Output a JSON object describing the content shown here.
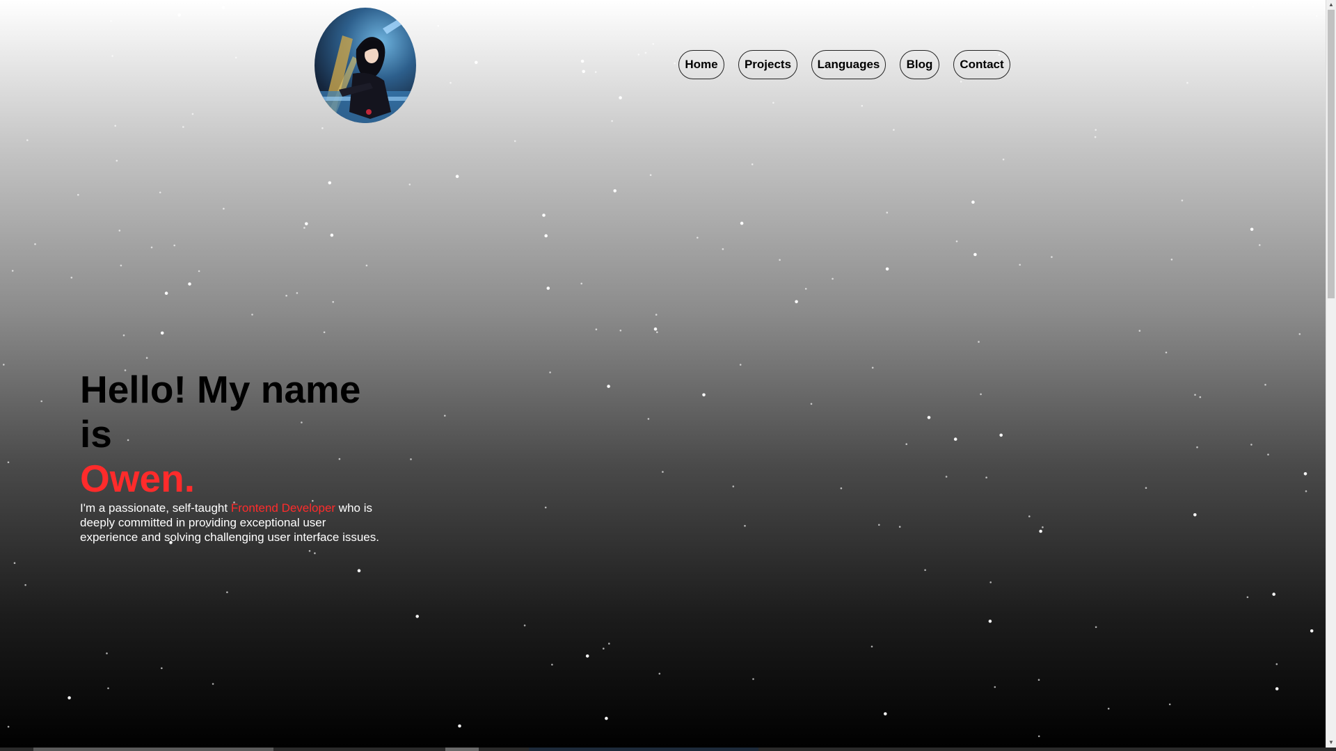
{
  "nav": {
    "items": [
      {
        "label": "Home"
      },
      {
        "label": "Projects"
      },
      {
        "label": "Languages"
      },
      {
        "label": "Blog"
      },
      {
        "label": "Contact"
      }
    ]
  },
  "hero": {
    "greeting": "Hello! My name is",
    "name": "Owen.",
    "bio_prefix": "I'm a passionate, self-taught ",
    "bio_highlight": "Frontend Developer",
    "bio_suffix": " who is deeply committed in providing exceptional user experience and solving challenging user interface issues."
  },
  "colors": {
    "accent": "#ff2b2b",
    "text_dark": "#000000",
    "text_light": "#ffffff"
  },
  "icons": {
    "avatar": "profile-avatar",
    "scroll_up": "scroll-up-icon",
    "scroll_down": "scroll-down-icon"
  }
}
